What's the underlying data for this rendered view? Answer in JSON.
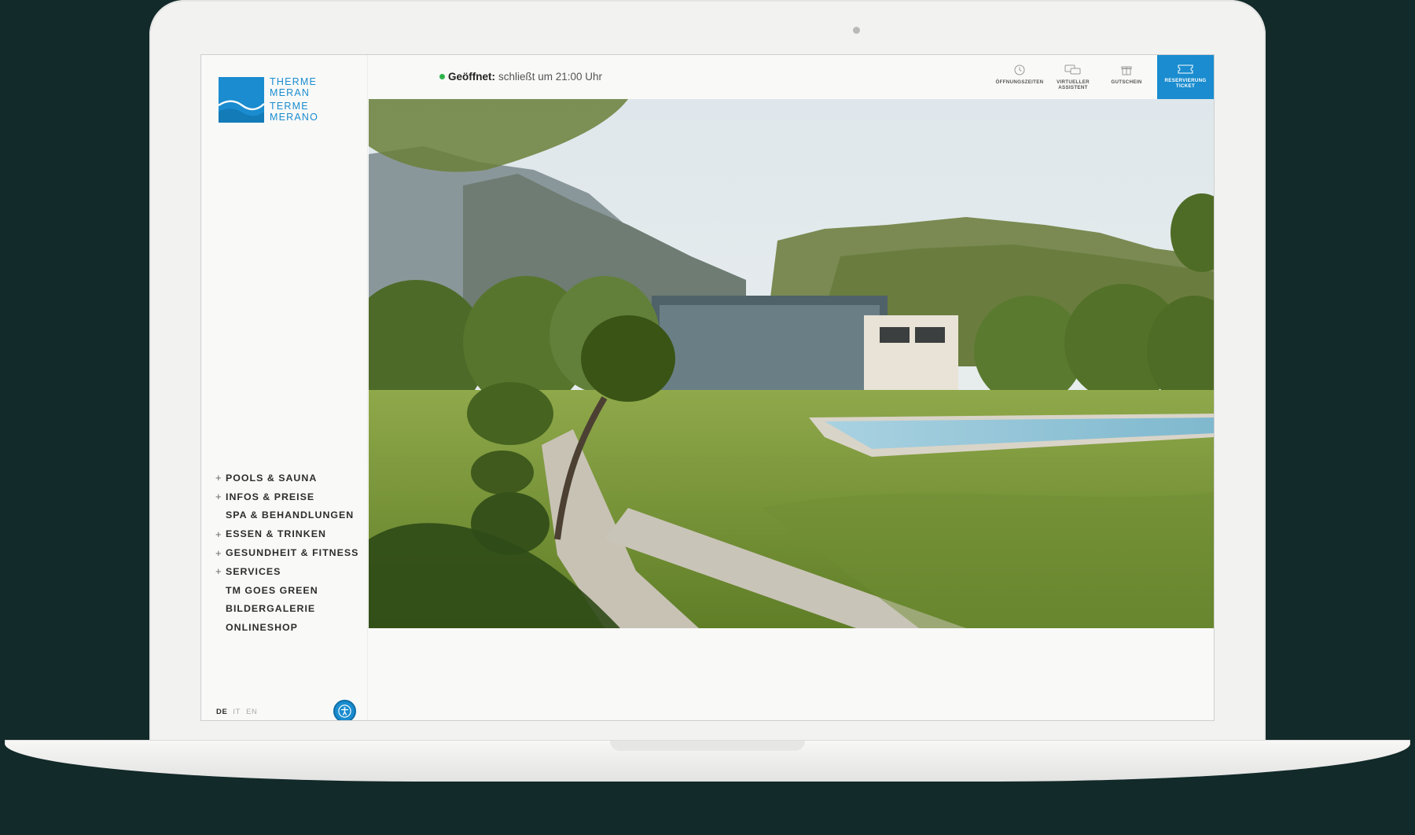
{
  "brand": {
    "name_de_1": "THERME",
    "name_de_2": "MERAN",
    "name_it_1": "TERME",
    "name_it_2": "MERANO",
    "color": "#1a8ccf"
  },
  "status": {
    "label": "Geöffnet:",
    "text": "schließt um 21:00 Uhr",
    "color": "#2eb34a"
  },
  "top_actions": [
    {
      "label": "ÖFFNUNGSZEITEN",
      "icon": "clock-icon"
    },
    {
      "label": "VIRTUELLER ASSISTENT",
      "icon": "chat-icon"
    },
    {
      "label": "GUTSCHEIN",
      "icon": "gift-icon"
    },
    {
      "label": "RESERVIERUNG TICKET",
      "icon": "ticket-icon"
    }
  ],
  "nav": [
    {
      "label": "POOLS & SAUNA",
      "expandable": true
    },
    {
      "label": "INFOS & PREISE",
      "expandable": true
    },
    {
      "label": "SPA & BEHANDLUNGEN",
      "expandable": false
    },
    {
      "label": "ESSEN & TRINKEN",
      "expandable": true
    },
    {
      "label": "GESUNDHEIT & FITNESS",
      "expandable": true
    },
    {
      "label": "SERVICES",
      "expandable": true
    },
    {
      "label": "TM GOES GREEN",
      "expandable": false
    },
    {
      "label": "BILDERGALERIE",
      "expandable": false
    },
    {
      "label": "ONLINESHOP",
      "expandable": false
    }
  ],
  "languages": [
    "DE",
    "IT",
    "EN"
  ],
  "active_language": "DE"
}
